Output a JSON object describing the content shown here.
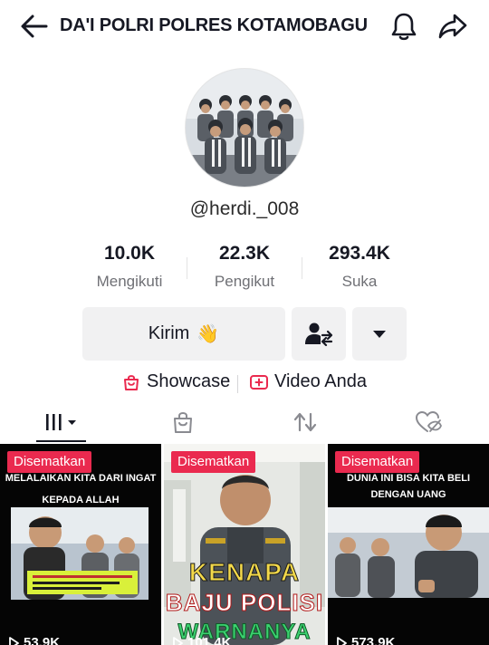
{
  "header": {
    "title": "DA'I POLRI POLRES KOTAMOBAGU",
    "back_icon": "arrow-left-icon",
    "bell_icon": "bell-icon",
    "share_icon": "share-arrow-icon"
  },
  "profile": {
    "username": "@herdi._008"
  },
  "stats": [
    {
      "value": "10.0K",
      "label": "Mengikuti"
    },
    {
      "value": "22.3K",
      "label": "Pengikut"
    },
    {
      "value": "293.4K",
      "label": "Suka"
    }
  ],
  "actions": {
    "message_label": "Kirim",
    "message_emoji": "👋",
    "friend_icon": "add-friend-swap-icon",
    "more_icon": "caret-down-icon"
  },
  "links": {
    "showcase_label": "Showcase",
    "video_label": "Video Anda"
  },
  "tabs": [
    {
      "icon": "videos-grid-icon",
      "active": true
    },
    {
      "icon": "shopping-bag-icon",
      "active": false
    },
    {
      "icon": "repost-icon",
      "active": false
    },
    {
      "icon": "liked-hidden-icon",
      "active": false
    }
  ],
  "videos": [
    {
      "badge": "Disematkan",
      "views": "53.9K",
      "caption_top": "MELALAIKAN KITA DARI INGAT",
      "caption_mid": "KEPADA ALLAH"
    },
    {
      "badge": "Disematkan",
      "views": "101.4K",
      "caption_a": "KENAPA",
      "caption_b": "BAJU POLISI",
      "caption_c": "WARNANYA"
    },
    {
      "badge": "Disematkan",
      "views": "573.9K",
      "caption_top": "DUNIA INI BISA KITA BELI",
      "caption_mid": "DENGAN UANG"
    }
  ],
  "colors": {
    "accent": "#ea2a4f",
    "text": "#161823",
    "muted": "#6f7075",
    "button_bg": "#f1f1f2"
  }
}
